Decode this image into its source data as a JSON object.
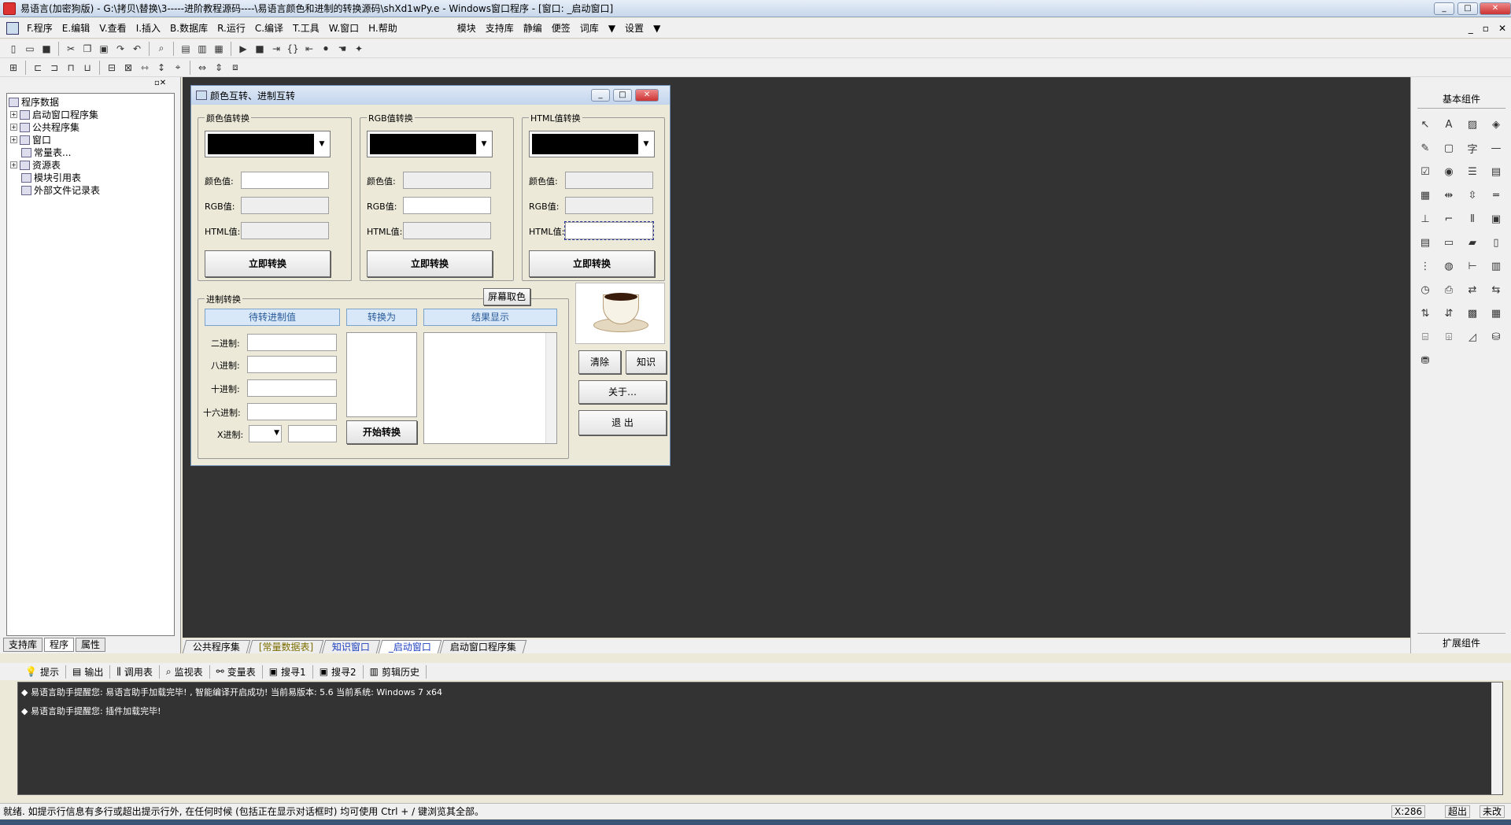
{
  "window": {
    "title": "易语言(加密狗版) - G:\\拷贝\\替换\\3-----进阶教程源码----\\易语言颜色和进制的转换源码\\shXd1wPy.e - Windows窗口程序 - [窗口: _启动窗口]",
    "min": "_",
    "max": "□",
    "close": "✕"
  },
  "menu": {
    "items": [
      "F.程序",
      "E.编辑",
      "V.查看",
      "I.插入",
      "B.数据库",
      "R.运行",
      "C.编译",
      "T.工具",
      "W.窗口",
      "H.帮助"
    ],
    "right_items": [
      "模块",
      "支持库",
      "静编",
      "便签",
      "词库",
      "▼",
      "设置",
      "▼"
    ],
    "mdi_controls": [
      "_",
      "▫",
      "✕"
    ]
  },
  "tree": {
    "root": "程序数据",
    "nodes": [
      {
        "label": "启动窗口程序集",
        "expander": "+"
      },
      {
        "label": "公共程序集",
        "expander": "+"
      },
      {
        "label": "窗口",
        "expander": "+"
      },
      {
        "label": "常量表...",
        "expander": ""
      },
      {
        "label": "资源表",
        "expander": "+"
      },
      {
        "label": "模块引用表",
        "expander": ""
      },
      {
        "label": "外部文件记录表",
        "expander": ""
      }
    ]
  },
  "left_tabs": [
    "支持库",
    "程序",
    "属性"
  ],
  "design": {
    "title": "颜色互转、进制互转",
    "groups": {
      "color": "颜色值转换",
      "rgb": "RGB值转换",
      "html": "HTML值转换",
      "base": "进制转换"
    },
    "labels": {
      "color_value": "颜色值:",
      "rgb_value": "RGB值:",
      "html_value": "HTML值:"
    },
    "convert_button": "立即转换",
    "screen_pick": "屏幕取色",
    "headers": {
      "input": "待转进制值",
      "to": "转换为",
      "result": "结果显示"
    },
    "base_labels": [
      "二进制:",
      "八进制:",
      "十进制:",
      "十六进制:",
      "X进制:"
    ],
    "start_button": "开始转换",
    "clear_button": "清除",
    "know_button": "知识",
    "about_button": "关于…",
    "exit_button": "退  出"
  },
  "right_panel": {
    "basic": "基本组件",
    "ext": "扩展组件"
  },
  "doc_tabs": [
    "公共程序集",
    "[常量数据表]",
    "知识窗口",
    "_启动窗口",
    "启动窗口程序集"
  ],
  "output_tabs": [
    "提示",
    "输出",
    "调用表",
    "监视表",
    "变量表",
    "搜寻1",
    "搜寻2",
    "剪辑历史"
  ],
  "output_lines": [
    "◆ 易语言助手提醒您: 易语言助手加载完毕!  , 智能编译开启成功!  当前易版本: 5.6  当前系统: Windows 7 x64",
    "◆ 易语言助手提醒您: 插件加载完毕!"
  ],
  "status": {
    "text": "就绪. 如提示行信息有多行或超出提示行外, 在任何时候 (包括正在显示对话框时) 均可使用 Ctrl + / 键浏览其全部。",
    "coord": "X:286",
    "mode1": "超出",
    "mode2": "未改"
  }
}
